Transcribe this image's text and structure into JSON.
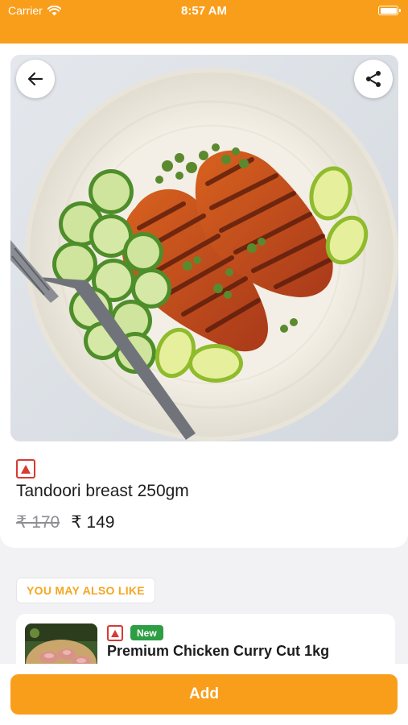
{
  "status_bar": {
    "carrier": "Carrier",
    "time": "8:57 AM"
  },
  "product": {
    "title": "Tandoori breast 250gm",
    "price_original": "₹ 170",
    "price_current": "₹ 149",
    "food_type_icon": "non-veg-mark-icon"
  },
  "toolbar": {
    "back_icon": "arrow-left-icon",
    "share_icon": "share-icon"
  },
  "recommendations": {
    "section_label": "YOU MAY ALSO LIKE",
    "items": [
      {
        "badge": "New",
        "title": "Premium Chicken Curry Cut 1kg"
      }
    ]
  },
  "footer": {
    "add_label": "Add"
  },
  "colors": {
    "accent": "#f99e1a",
    "non_veg": "#d63a32",
    "new_badge": "#2e9e45"
  }
}
